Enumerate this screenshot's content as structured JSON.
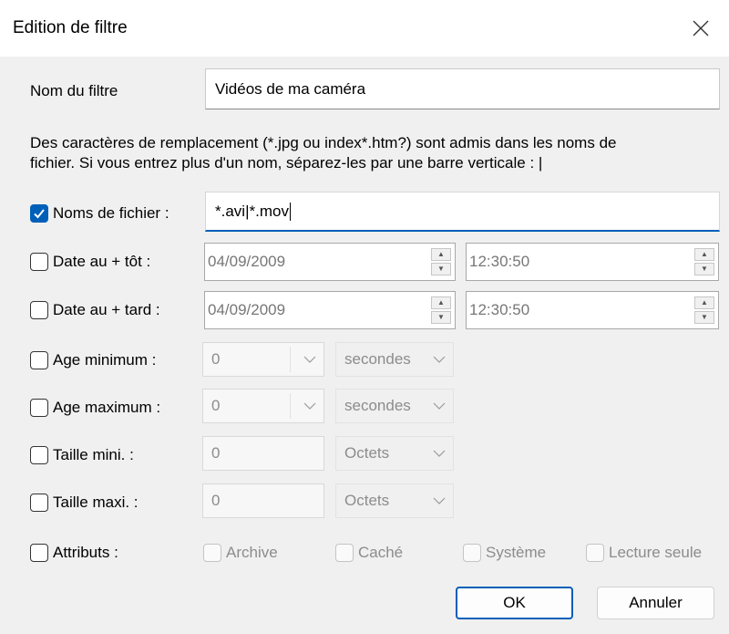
{
  "window": {
    "title": "Edition de filtre"
  },
  "filter_name": {
    "label": "Nom du filtre",
    "value": "Vidéos de ma caméra"
  },
  "help_text": {
    "line1": "Des caractères de remplacement (*.jpg ou index*.htm?) sont admis dans les noms de",
    "line2": "fichier. Si vous entrez plus d'un nom, séparez-les par une barre verticale : |"
  },
  "filenames": {
    "label": "Noms de fichier :",
    "value": "*.avi|*.mov",
    "checked": true
  },
  "date_earliest": {
    "label": "Date au + tôt :",
    "date": "04/09/2009",
    "time": "12:30:50"
  },
  "date_latest": {
    "label": "Date au + tard :",
    "date": "04/09/2009",
    "time": "12:30:50"
  },
  "age_min": {
    "label": "Age minimum :",
    "value": "0",
    "unit": "secondes"
  },
  "age_max": {
    "label": "Age maximum :",
    "value": "0",
    "unit": "secondes"
  },
  "size_min": {
    "label": "Taille mini. :",
    "value": "0",
    "unit": "Octets"
  },
  "size_max": {
    "label": "Taille maxi. :",
    "value": "0",
    "unit": "Octets"
  },
  "attributes": {
    "label": "Attributs :",
    "options": [
      "Archive",
      "Caché",
      "Système",
      "Lecture seule"
    ]
  },
  "buttons": {
    "ok": "OK",
    "cancel": "Annuler"
  },
  "colors": {
    "accent": "#005fb8",
    "background": "#f0f0f0"
  },
  "icons": [
    "close-icon",
    "check-icon",
    "spin-up-icon",
    "spin-down-icon",
    "chevron-down-icon"
  ]
}
